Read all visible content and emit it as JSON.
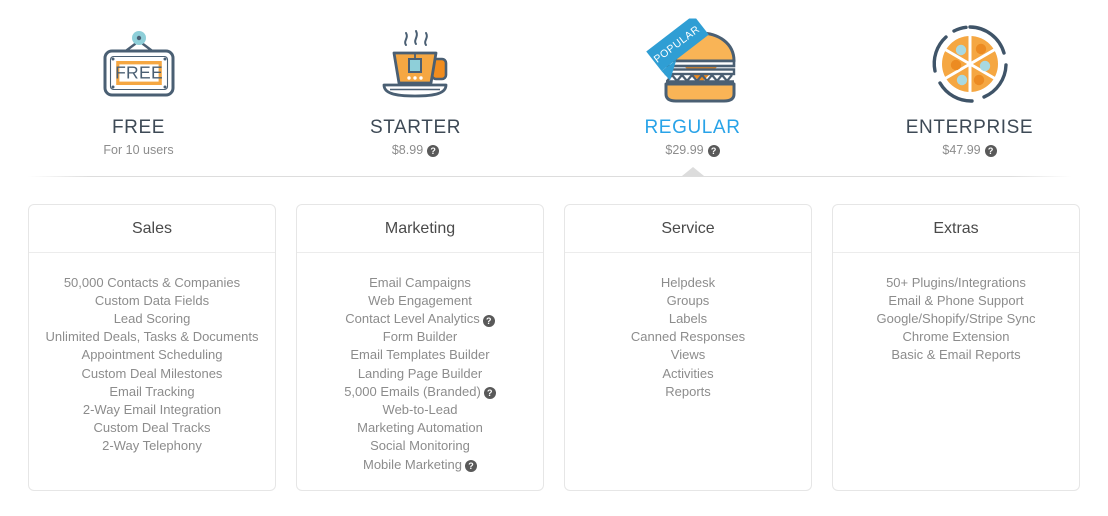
{
  "plans": [
    {
      "id": "free",
      "name": "FREE",
      "sub": "For 10 users",
      "has_help": false,
      "selected": false,
      "badge": null,
      "icon": "free-sign-icon"
    },
    {
      "id": "starter",
      "name": "STARTER",
      "sub": "$8.99",
      "has_help": true,
      "selected": false,
      "badge": null,
      "icon": "teacup-icon"
    },
    {
      "id": "regular",
      "name": "REGULAR",
      "sub": "$29.99",
      "has_help": true,
      "selected": true,
      "badge": "POPULAR",
      "icon": "hamburger-icon"
    },
    {
      "id": "enterprise",
      "name": "ENTERPRISE",
      "sub": "$47.99",
      "has_help": true,
      "selected": false,
      "badge": null,
      "icon": "pizza-icon"
    }
  ],
  "help_glyph": "?",
  "cards": [
    {
      "id": "sales",
      "title": "Sales",
      "features": [
        {
          "label": "50,000 Contacts & Companies",
          "help": false
        },
        {
          "label": "Custom Data Fields",
          "help": false
        },
        {
          "label": "Lead Scoring",
          "help": false
        },
        {
          "label": "Unlimited Deals, Tasks & Documents",
          "help": false
        },
        {
          "label": "Appointment Scheduling",
          "help": false
        },
        {
          "label": "Custom Deal Milestones",
          "help": false
        },
        {
          "label": "Email Tracking",
          "help": false
        },
        {
          "label": "2-Way Email Integration",
          "help": false
        },
        {
          "label": "Custom Deal Tracks",
          "help": false
        },
        {
          "label": "2-Way Telephony",
          "help": false
        }
      ]
    },
    {
      "id": "marketing",
      "title": "Marketing",
      "features": [
        {
          "label": "Email Campaigns",
          "help": false
        },
        {
          "label": "Web Engagement",
          "help": false
        },
        {
          "label": "Contact Level Analytics",
          "help": true
        },
        {
          "label": "Form Builder",
          "help": false
        },
        {
          "label": "Email Templates Builder",
          "help": false
        },
        {
          "label": "Landing Page Builder",
          "help": false
        },
        {
          "label": "5,000 Emails (Branded)",
          "help": true
        },
        {
          "label": "Web-to-Lead",
          "help": false
        },
        {
          "label": "Marketing Automation",
          "help": false
        },
        {
          "label": "Social Monitoring",
          "help": false
        },
        {
          "label": "Mobile Marketing",
          "help": true
        }
      ]
    },
    {
      "id": "service",
      "title": "Service",
      "features": [
        {
          "label": "Helpdesk",
          "help": false
        },
        {
          "label": "Groups",
          "help": false
        },
        {
          "label": "Labels",
          "help": false
        },
        {
          "label": "Canned Responses",
          "help": false
        },
        {
          "label": "Views",
          "help": false
        },
        {
          "label": "Activities",
          "help": false
        },
        {
          "label": "Reports",
          "help": false
        }
      ]
    },
    {
      "id": "extras",
      "title": "Extras",
      "features": [
        {
          "label": "50+ Plugins/Integrations",
          "help": false
        },
        {
          "label": "Email & Phone Support",
          "help": false
        },
        {
          "label": "Google/Shopify/Stripe Sync",
          "help": false
        },
        {
          "label": "Chrome Extension",
          "help": false
        },
        {
          "label": "Basic & Email Reports",
          "help": false
        }
      ]
    }
  ],
  "colors": {
    "selected_plan": "#29a3e8",
    "plan_name": "#3e4a56",
    "feature_text": "#8c8c8c",
    "card_border": "#e6e6e6",
    "icon_outline": "#4a5f73",
    "icon_orange": "#f5a742",
    "icon_orange_dark": "#f08c1e",
    "icon_teal": "#8ecfd9",
    "ribbon_blue": "#2f9ed4"
  }
}
